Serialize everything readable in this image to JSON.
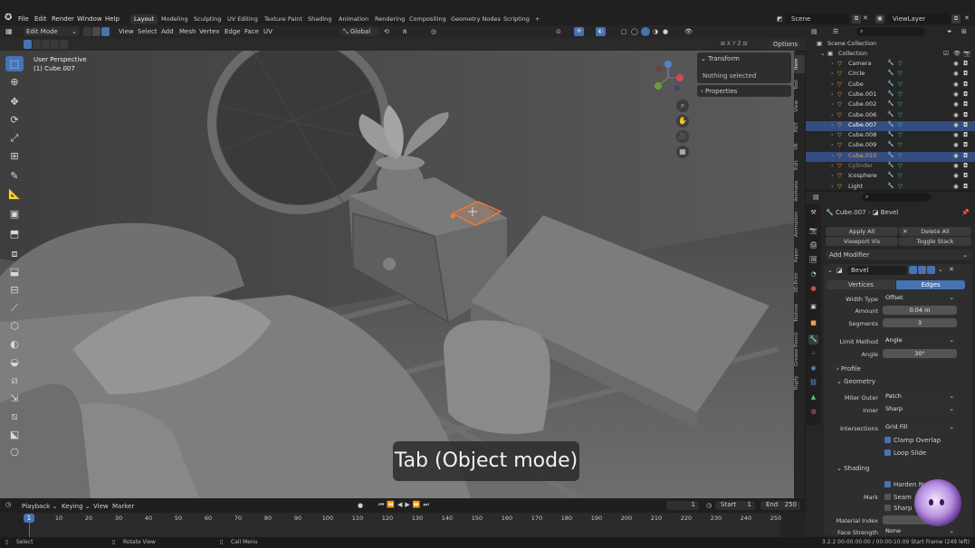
{
  "topbar": {
    "menus": [
      "File",
      "Edit",
      "Render",
      "Window",
      "Help"
    ],
    "workspaces": [
      "Layout",
      "Modeling",
      "Sculpting",
      "UV Editing",
      "Texture Paint",
      "Shading",
      "Animation",
      "Rendering",
      "Compositing",
      "Geometry Nodes",
      "Scripting"
    ],
    "active_workspace": "Layout",
    "add_tab": "+",
    "scene": "Scene",
    "view_layer": "ViewLayer"
  },
  "viewport_header": {
    "mode": "Edit Mode",
    "menus": [
      "View",
      "Select",
      "Add",
      "Mesh",
      "Vertex",
      "Edge",
      "Face",
      "UV"
    ],
    "orientation": "Global",
    "options": "Options"
  },
  "viewport": {
    "view_name": "User Perspective",
    "object_name": "(1) Cube.007",
    "caption": "Tab (Object mode)",
    "npanel": {
      "transform_title": "Transform",
      "transform_status": "Nothing selected",
      "properties_title": "Properties"
    },
    "side_tabs": [
      "Item",
      "Tool",
      "View",
      "PDT",
      "VR",
      "Edit",
      "Animate",
      "Animation",
      "Paper",
      "3D-Print",
      "Texture",
      "Grease Pencil",
      "Rigify"
    ]
  },
  "outliner": {
    "root": "Scene Collection",
    "collection": "Collection",
    "items": [
      {
        "name": "Camera",
        "color": "#d6d6d6",
        "selected": false
      },
      {
        "name": "Circle",
        "color": "#d6d6d6",
        "selected": false
      },
      {
        "name": "Cube",
        "color": "#d6d6d6",
        "selected": false
      },
      {
        "name": "Cube.001",
        "color": "#d6d6d6",
        "selected": false
      },
      {
        "name": "Cube.002",
        "color": "#d6d6d6",
        "selected": false
      },
      {
        "name": "Cube.006",
        "color": "#d6d6d6",
        "selected": false
      },
      {
        "name": "Cube.007",
        "color": "#ffffff",
        "selected": true
      },
      {
        "name": "Cube.008",
        "color": "#d6d6d6",
        "selected": false
      },
      {
        "name": "Cube.009",
        "color": "#d6d6d6",
        "selected": false
      },
      {
        "name": "Cube.010",
        "color": "#f0a05a",
        "selected": true
      },
      {
        "name": "Cylinder",
        "color": "#8a8a8a",
        "selected": false
      },
      {
        "name": "Icosphere",
        "color": "#d6d6d6",
        "selected": false
      },
      {
        "name": "Light",
        "color": "#d6d6d6",
        "selected": false
      }
    ]
  },
  "properties": {
    "breadcrumb_object": "Cube.007",
    "breadcrumb_modifier": "Bevel",
    "apply_all": "Apply All",
    "delete_all": "Delete All",
    "viewport_vis": "Viewport Vis",
    "toggle_stack": "Toggle Stack",
    "add_modifier": "Add Modifier",
    "modifier_name": "Bevel",
    "tab_vertices": "Vertices",
    "tab_edges": "Edges",
    "width_type_label": "Width Type",
    "width_type": "Offset",
    "amount_label": "Amount",
    "amount": "0.04 m",
    "segments_label": "Segments",
    "segments": "3",
    "limit_method_label": "Limit Method",
    "limit_method": "Angle",
    "angle_label": "Angle",
    "angle": "30°",
    "profile": "Profile",
    "geometry": "Geometry",
    "miter_outer_label": "Miter Outer",
    "miter_outer": "Patch",
    "inner_label": "Inner",
    "inner": "Sharp",
    "intersections_label": "Intersections",
    "intersections": "Grid Fill",
    "clamp_overlap": "Clamp Overlap",
    "loop_slide": "Loop Slide",
    "shading": "Shading",
    "harden_normals": "Harden Norm",
    "mark_label": "Mark",
    "seam": "Seam",
    "sharp": "Sharp",
    "material_index_label": "Material Index",
    "face_strength_label": "Face Strength",
    "face_strength": "None"
  },
  "timeline": {
    "menus": [
      "Playback",
      "Keying",
      "View",
      "Marker"
    ],
    "current_frame": "1",
    "start_label": "Start",
    "start": "1",
    "end_label": "End",
    "end": "250",
    "ticks": [
      "0",
      "10",
      "20",
      "30",
      "40",
      "50",
      "60",
      "70",
      "80",
      "90",
      "100",
      "110",
      "120",
      "130",
      "140",
      "150",
      "160",
      "170",
      "180",
      "190",
      "200",
      "210",
      "220",
      "230",
      "240",
      "250"
    ],
    "playhead": "1"
  },
  "statusbar": {
    "select": "Select",
    "rotate": "Rotate View",
    "call_menu": "Call Menu",
    "info": "3.2.2   00:00:00:00 / 00:00:10:09   Start Frame (249 left)"
  },
  "colors": {
    "accent": "#4772b3",
    "selection": "#f07a35",
    "viewport": "#5c5c5c"
  }
}
